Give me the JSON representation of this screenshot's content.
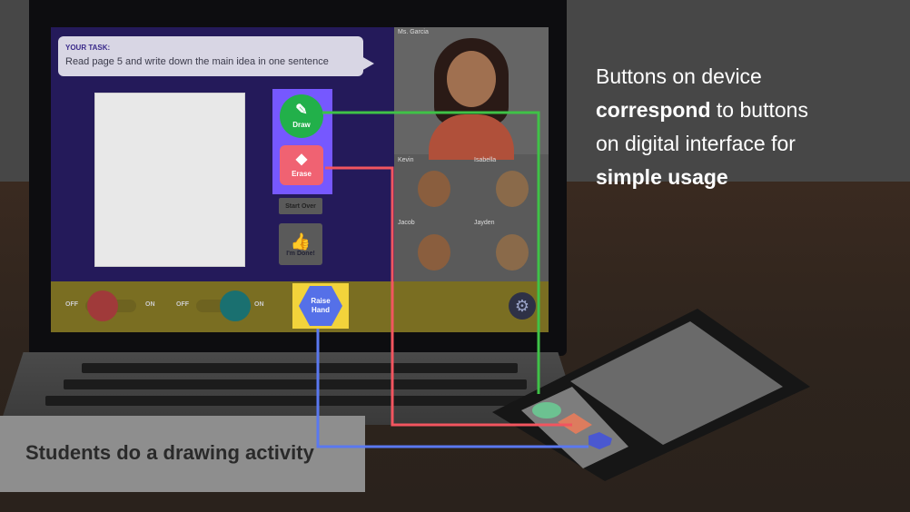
{
  "headline": {
    "line1": "Buttons on device",
    "line2_bold": "correspond",
    "line2_rest": " to buttons",
    "line3": "on digital interface for",
    "line4_bold": "simple usage"
  },
  "caption": "Students do a drawing activity",
  "task": {
    "title": "YOUR TASK:",
    "text": "Read page 5 and write down the main idea in one sentence"
  },
  "tools": {
    "draw_label": "Draw",
    "erase_label": "Erase",
    "start_over_label": "Start Over",
    "done_label": "I'm Done!"
  },
  "participants": {
    "teacher": "Ms. Garcia",
    "students": [
      "Kevin",
      "Isabella",
      "Jacob",
      "Jayden"
    ]
  },
  "bottom_bar": {
    "mic_off": "OFF",
    "mic_on": "ON",
    "cam_off": "OFF",
    "cam_on": "ON",
    "raise_hand_line1": "Raise",
    "raise_hand_line2": "Hand"
  },
  "colors": {
    "draw": "#22b04a",
    "erase": "#f06272",
    "raise_hand": "#5570e8",
    "highlight_tools": "#7658ff",
    "highlight_raise": "#f2d33b"
  },
  "icons": {
    "draw": "pencil-icon",
    "erase": "eraser-icon",
    "done": "thumbs-up-icon",
    "mic": "microphone-icon",
    "camera": "video-camera-icon",
    "settings": "gear-icon"
  }
}
